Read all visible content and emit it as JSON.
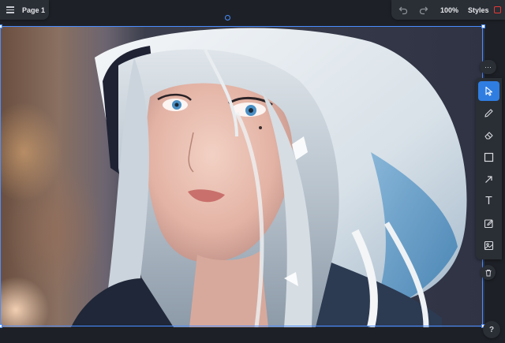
{
  "page_menu": {
    "page_name": "Page 1",
    "menu_icon": "hamburger-menu-icon"
  },
  "toolbar": {
    "undo_icon": "undo-icon",
    "redo_icon": "redo-icon",
    "zoom": "100%",
    "styles_label": "Styles",
    "styles_color": "#e53935"
  },
  "tools": {
    "more_label": "···",
    "items": [
      {
        "name": "select",
        "icon": "cursor-arrow-icon",
        "active": true
      },
      {
        "name": "draw",
        "icon": "pencil-icon",
        "active": false
      },
      {
        "name": "eraser",
        "icon": "eraser-icon",
        "active": false
      },
      {
        "name": "rectangle",
        "icon": "rectangle-icon",
        "active": false
      },
      {
        "name": "arrow",
        "icon": "arrow-icon",
        "active": false
      },
      {
        "name": "text",
        "icon": "text-icon",
        "active": false
      },
      {
        "name": "note",
        "icon": "note-edit-icon",
        "active": false
      },
      {
        "name": "image",
        "icon": "image-icon",
        "active": false
      }
    ],
    "text_glyph": "T",
    "delete_icon": "trash-icon",
    "help_label": "?"
  },
  "colors": {
    "accent": "#2f7de1",
    "selection": "#4a8dff",
    "panel": "#2a2e35",
    "background": "#1d2127"
  }
}
